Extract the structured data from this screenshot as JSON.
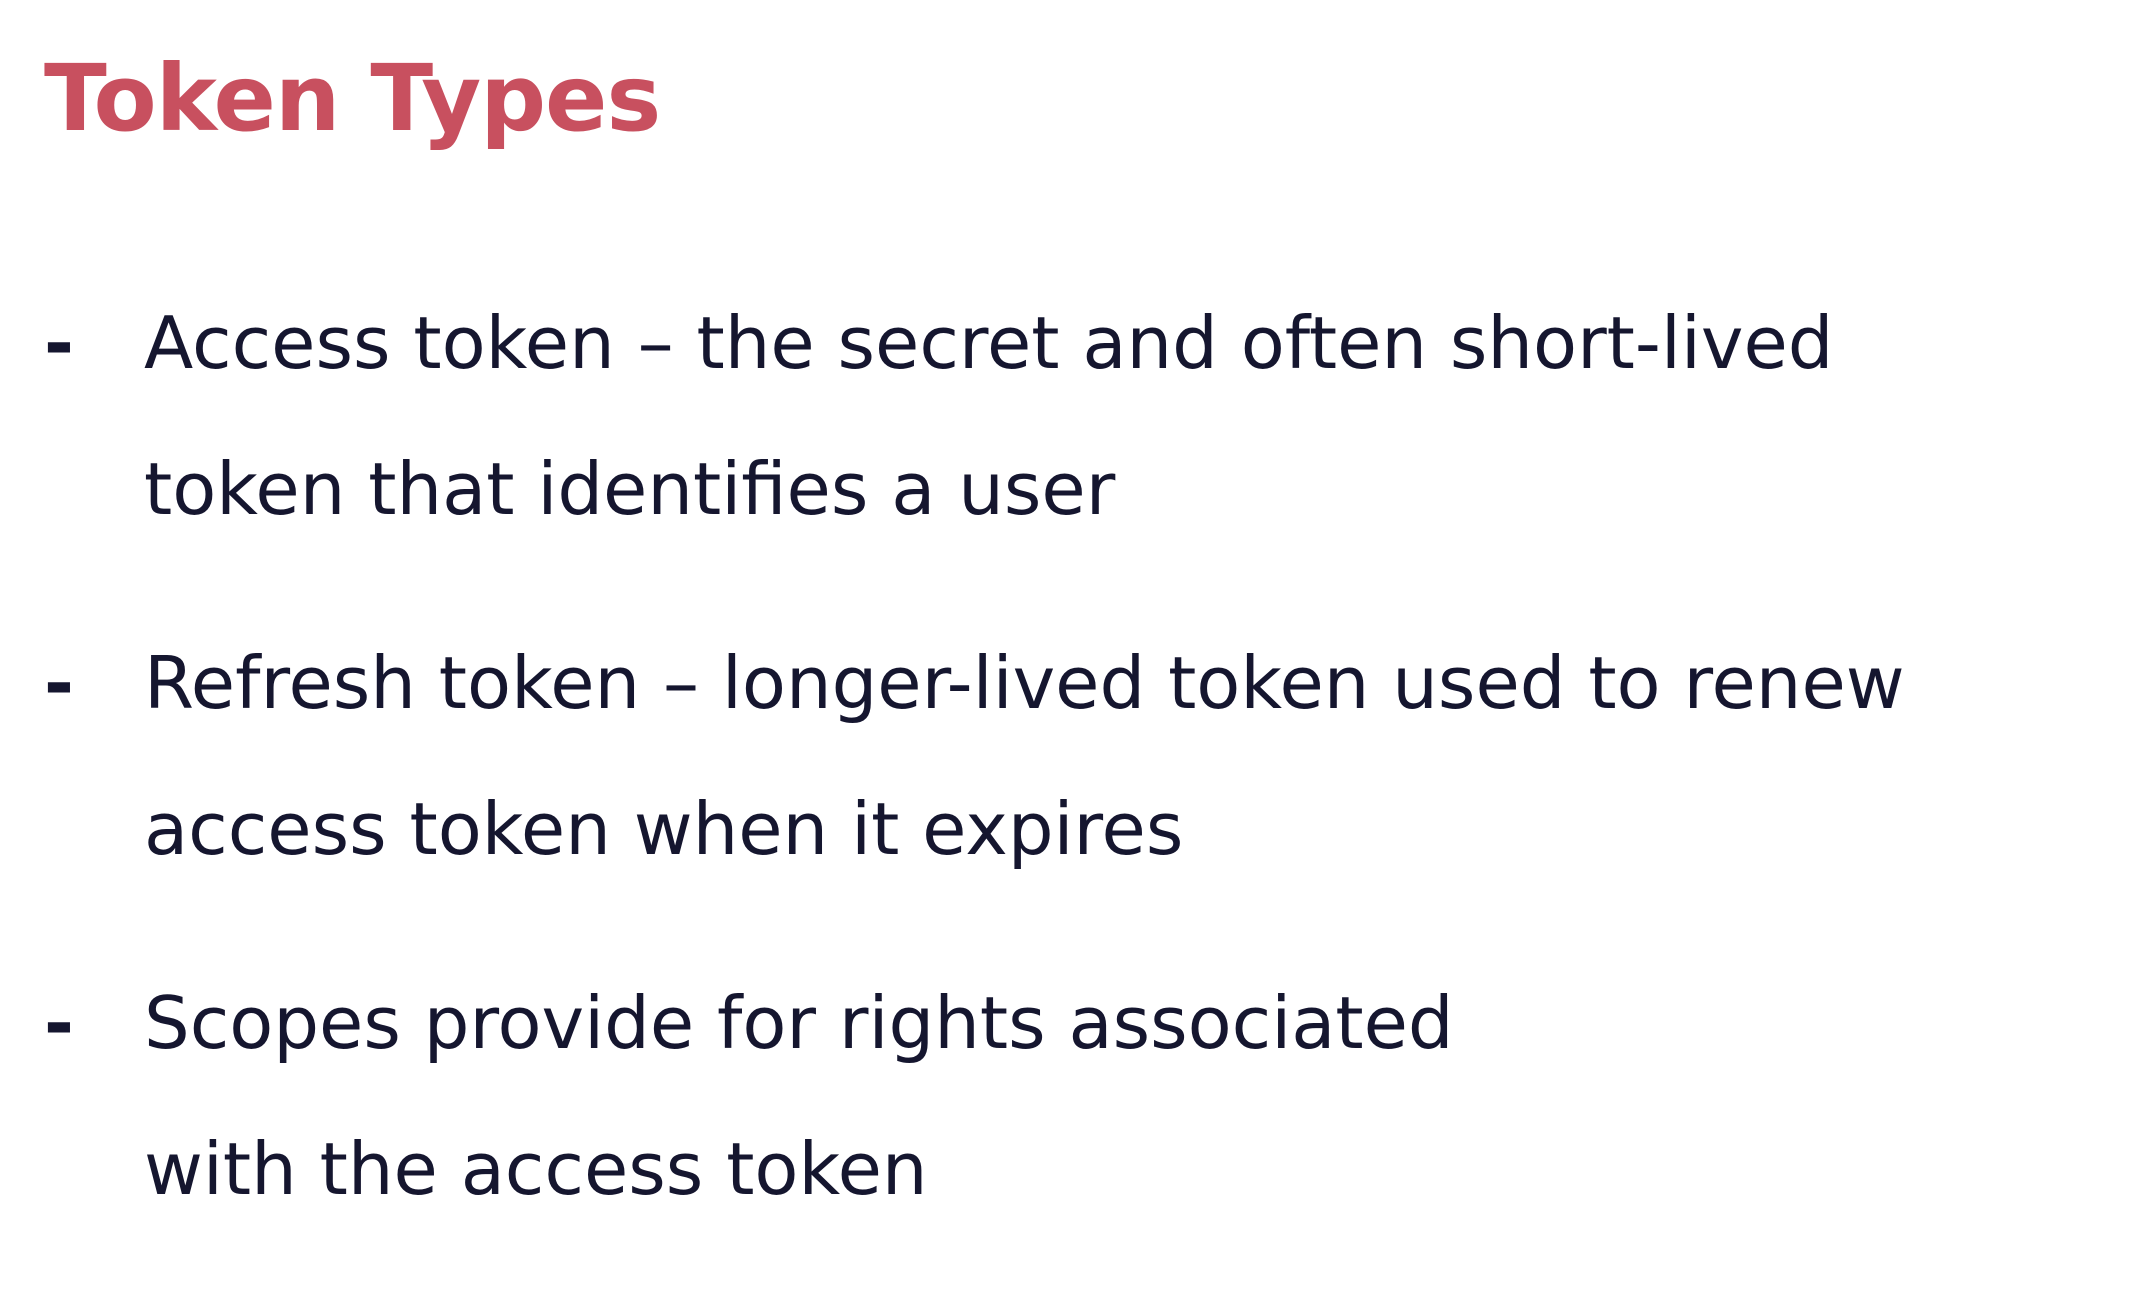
{
  "slide": {
    "title": "Token Types",
    "bullets": [
      {
        "marker": "-",
        "line1": "Access token – the secret and often short-lived",
        "line2": "token that identifies a user"
      },
      {
        "marker": "-",
        "line1": "Refresh token – longer-lived token used to renew",
        "line2": "access token when it expires"
      },
      {
        "marker": "-",
        "line1": "Scopes provide for rights associated",
        "line2": "with the access token"
      }
    ]
  },
  "colors": {
    "title": "#c8505f",
    "text": "#15162f",
    "background": "#ffffff"
  }
}
